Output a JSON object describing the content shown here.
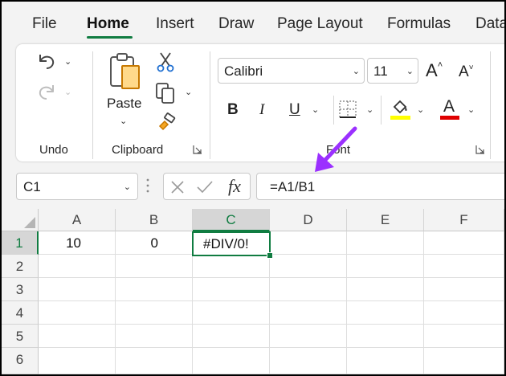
{
  "menu": {
    "tabs": [
      "File",
      "Home",
      "Insert",
      "Draw",
      "Page Layout",
      "Formulas",
      "Data"
    ],
    "active_tab": "Home"
  },
  "ribbon": {
    "undo_group": {
      "label": "Undo",
      "icons": [
        "undo-icon",
        "redo-icon"
      ]
    },
    "clipboard_group": {
      "label": "Clipboard",
      "paste_label": "Paste",
      "icons": [
        "paste-icon",
        "cut-icon",
        "copy-icon",
        "format-painter-icon"
      ]
    },
    "font_group": {
      "label": "Font",
      "font_name": "Calibri",
      "font_size": "11",
      "bold": "B",
      "italic": "I",
      "underline": "U",
      "increase_size": "A",
      "decrease_size": "A",
      "font_color_letter": "A",
      "highlight_color": "#ffff00",
      "font_color": "#e00000"
    }
  },
  "formula_bar": {
    "name_box": "C1",
    "fx": "fx",
    "formula": "=A1/B1"
  },
  "annotation": {
    "arrow_color": "#9b30ff"
  },
  "sheet": {
    "columns": [
      "A",
      "B",
      "C",
      "D",
      "E",
      "F"
    ],
    "rows": [
      "1",
      "2",
      "3",
      "4",
      "5",
      "6"
    ],
    "selected_cell": "C1",
    "cells": {
      "A1": "10",
      "B1": "0",
      "C1": "#DIV/0!"
    }
  },
  "theme": {
    "accent": "#107c41"
  }
}
